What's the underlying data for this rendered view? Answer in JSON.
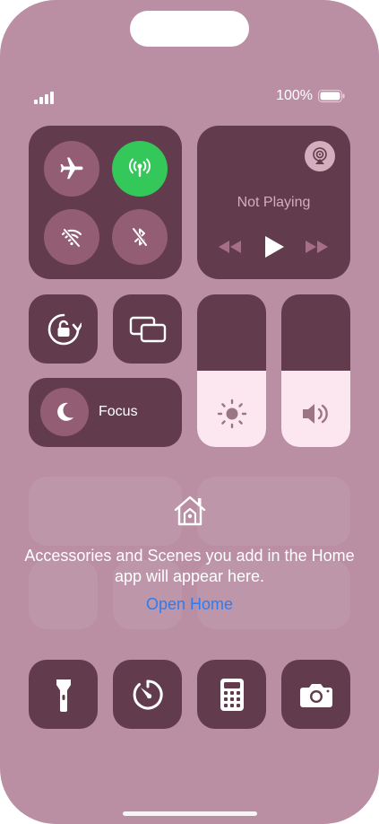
{
  "status_bar": {
    "battery": "100%"
  },
  "connectivity": {
    "airplane": {
      "icon": "airplane-icon",
      "state": "off"
    },
    "cellular": {
      "icon": "cellular-antenna-icon",
      "state": "on"
    },
    "wifi": {
      "icon": "wifi-off-icon",
      "state": "off"
    },
    "bluetooth": {
      "icon": "bluetooth-off-icon",
      "state": "off"
    }
  },
  "now_playing": {
    "status": "Not Playing",
    "airplay_icon": "airplay-icon"
  },
  "focus": {
    "label": "Focus",
    "icon": "moon-icon"
  },
  "sliders": {
    "brightness": 0.5,
    "volume": 0.5
  },
  "home": {
    "message": "Accessories and Scenes you add in the Home app will appear here.",
    "link": "Open Home"
  },
  "bottom_controls": [
    "flashlight-icon",
    "timer-icon",
    "calculator-icon",
    "camera-icon"
  ],
  "colors": {
    "background": "#ba8ea3",
    "tile": "#623c4c",
    "circle": "#935d74",
    "active_green": "#34c759",
    "link_blue": "#2f7bef",
    "slider_fill": "#fce6ef"
  }
}
